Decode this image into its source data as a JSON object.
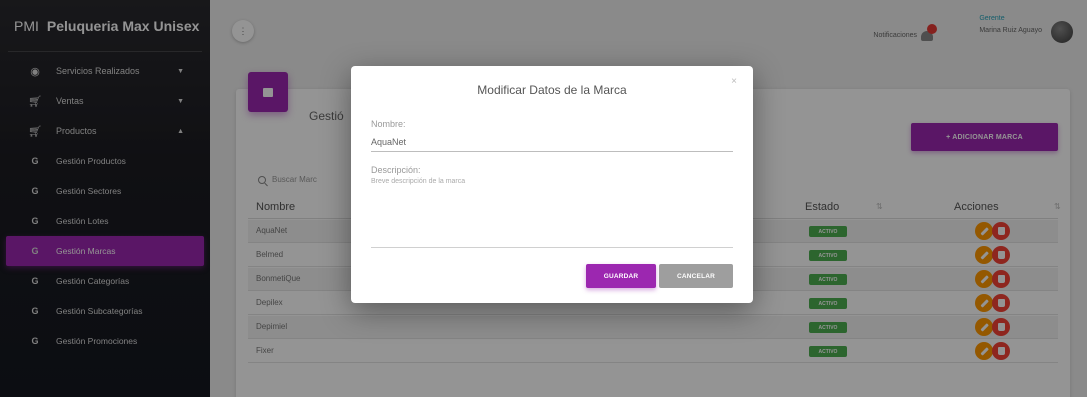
{
  "app": {
    "abbr": "PMI",
    "title": "Peluqueria Max Unisex"
  },
  "sidebar": {
    "items": [
      {
        "label": "Servicios Realizados",
        "icon": "eye-icon"
      },
      {
        "label": "Ventas",
        "icon": "cart-icon"
      },
      {
        "label": "Productos",
        "icon": "cart-icon"
      },
      {
        "label": "Gestión Productos",
        "abbr": "G"
      },
      {
        "label": "Gestión Sectores",
        "abbr": "G"
      },
      {
        "label": "Gestión Lotes",
        "abbr": "G"
      },
      {
        "label": "Gestión Marcas",
        "abbr": "G",
        "active": true
      },
      {
        "label": "Gestión Categorías",
        "abbr": "G"
      },
      {
        "label": "Gestión Subcategorías",
        "abbr": "G"
      },
      {
        "label": "Gestión Promociones",
        "abbr": "G"
      }
    ]
  },
  "topbar": {
    "menu_glyph": "⋮",
    "notifications_label": "Notificaciones",
    "user_role": "Gerente",
    "user_name": "Marina Ruiz Aguayo"
  },
  "card": {
    "title": "Gestió",
    "add_button": "+ ADICIONAR MARCA",
    "search_placeholder": "Buscar Marc",
    "columns": {
      "nombre": "Nombre",
      "estado": "Estado",
      "acciones": "Acciones"
    },
    "rows": [
      {
        "nombre": "AquaNet",
        "estado": "ACTIVO"
      },
      {
        "nombre": "Belmed",
        "estado": "ACTIVO"
      },
      {
        "nombre": "BonmetiQue",
        "estado": "ACTIVO"
      },
      {
        "nombre": "Depilex",
        "estado": "ACTIVO"
      },
      {
        "nombre": "Depimiel",
        "estado": "ACTIVO"
      },
      {
        "nombre": "Fixer",
        "estado": "ACTIVO"
      }
    ]
  },
  "modal": {
    "title": "Modificar Datos de la Marca",
    "close": "×",
    "nombre_label": "Nombre:",
    "nombre_value": "AquaNet",
    "descripcion_label": "Descripción:",
    "descripcion_placeholder": "Breve descripción de la marca",
    "save_button": "GUARDAR",
    "cancel_button": "CANCELAR"
  },
  "colors": {
    "accent": "#9c27b0",
    "status_active": "#4caf50",
    "edit": "#ff9800",
    "delete": "#f44336"
  }
}
